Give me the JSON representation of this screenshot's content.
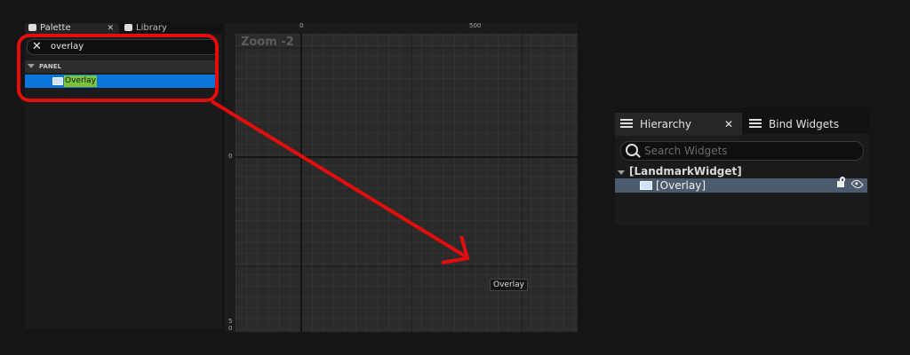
{
  "palette": {
    "tab_palette": "Palette",
    "tab_library": "Library",
    "search_value": "overlay",
    "category": "PANEL",
    "item": "Overlay"
  },
  "canvas": {
    "zoom": "Zoom -2",
    "ruler_top_0": "0",
    "ruler_top_500": "500",
    "ruler_left_0": "0",
    "ruler_left_5": "5",
    "ruler_left_0b": "0",
    "overlay_tag": "Overlay"
  },
  "hierarchy": {
    "tab_hierarchy": "Hierarchy",
    "tab_bind": "Bind Widgets",
    "search_placeholder": "Search Widgets",
    "root": "[LandmarkWidget]",
    "child": "[Overlay]"
  },
  "colors": {
    "selection_blue": "#0b74d9",
    "highlight_red": "#e40d0d",
    "match_green": "#7cc33c",
    "hier_selected": "#4b5a6c"
  }
}
